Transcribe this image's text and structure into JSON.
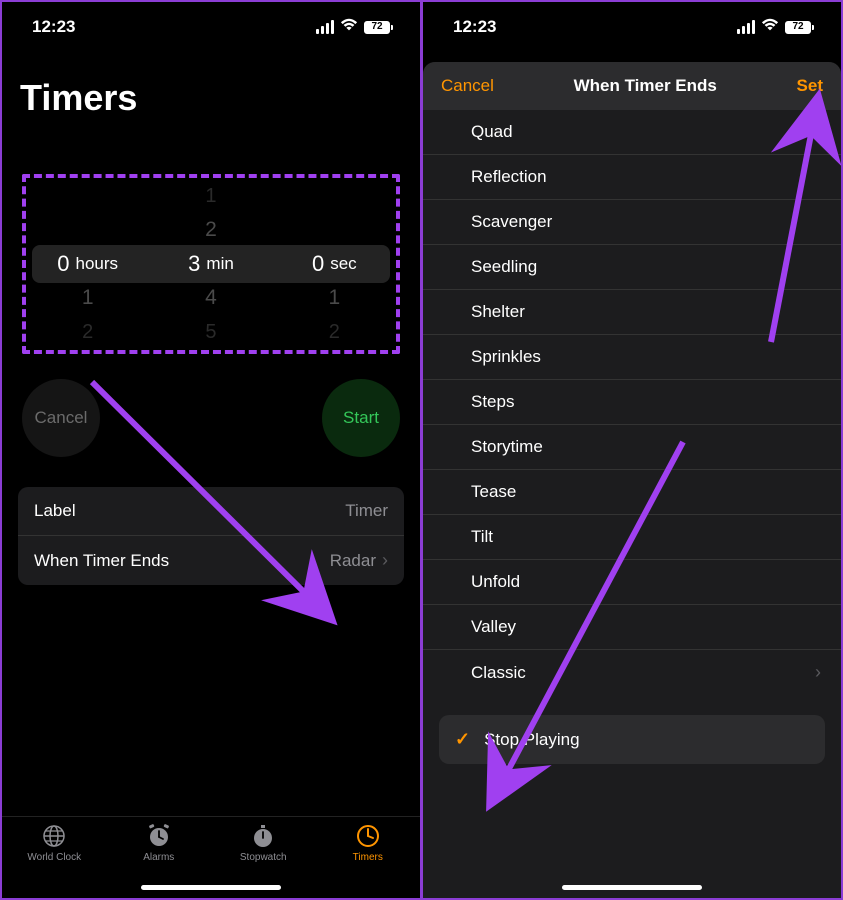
{
  "statusBar": {
    "time": "12:23",
    "battery": "72"
  },
  "left": {
    "title": "Timers",
    "picker": {
      "hours": {
        "selected": "0",
        "unit": "hours",
        "below1": "1",
        "below2": "2"
      },
      "minutes": {
        "above2": "1",
        "above1": "2",
        "selected": "3",
        "unit": "min",
        "below1": "4",
        "below2": "5"
      },
      "seconds": {
        "selected": "0",
        "unit": "sec",
        "below1": "1",
        "below2": "2"
      }
    },
    "buttons": {
      "cancel": "Cancel",
      "start": "Start"
    },
    "settings": {
      "labelKey": "Label",
      "labelVal": "Timer",
      "endsKey": "When Timer Ends",
      "endsVal": "Radar"
    },
    "tabs": {
      "worldClock": "World Clock",
      "alarms": "Alarms",
      "stopwatch": "Stopwatch",
      "timers": "Timers"
    }
  },
  "right": {
    "header": {
      "cancel": "Cancel",
      "title": "When Timer Ends",
      "set": "Set"
    },
    "sounds": [
      "Quad",
      "Reflection",
      "Scavenger",
      "Seedling",
      "Shelter",
      "Sprinkles",
      "Steps",
      "Storytime",
      "Tease",
      "Tilt",
      "Unfold",
      "Valley"
    ],
    "classic": "Classic",
    "stopPlaying": "Stop Playing"
  }
}
